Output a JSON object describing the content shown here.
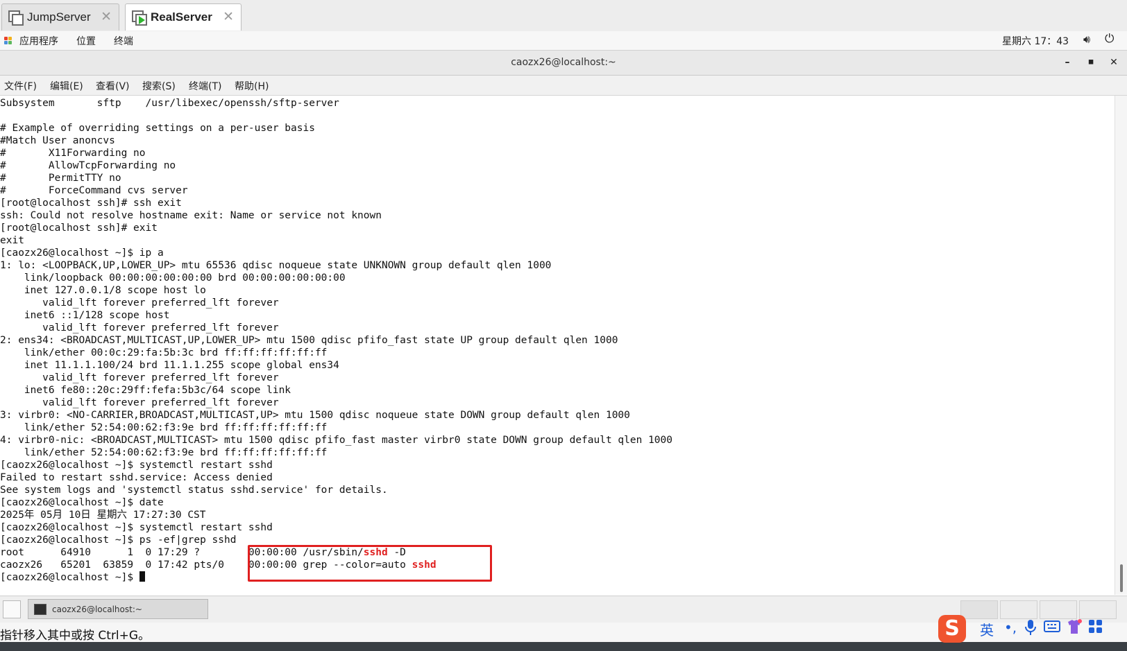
{
  "vm_tabs": [
    {
      "label": "JumpServer",
      "active": false
    },
    {
      "label": "RealServer",
      "active": true
    }
  ],
  "panel": {
    "applications": "应用程序",
    "places": "位置",
    "terminal": "终端",
    "datetime": "星期六 17：43",
    "icons": [
      "volume-icon",
      "power-icon"
    ]
  },
  "window": {
    "title": "caozx26@localhost:~",
    "controls": [
      "minimize",
      "maximize",
      "close"
    ]
  },
  "menu": [
    "文件(F)",
    "编辑(E)",
    "查看(V)",
    "搜索(S)",
    "终端(T)",
    "帮助(H)"
  ],
  "terminal": {
    "lines": [
      "Subsystem       sftp    /usr/libexec/openssh/sftp-server",
      "",
      "# Example of overriding settings on a per-user basis",
      "#Match User anoncvs",
      "#       X11Forwarding no",
      "#       AllowTcpForwarding no",
      "#       PermitTTY no",
      "#       ForceCommand cvs server",
      "[root@localhost ssh]# ssh exit",
      "ssh: Could not resolve hostname exit: Name or service not known",
      "[root@localhost ssh]# exit",
      "exit",
      "[caozx26@localhost ~]$ ip a",
      "1: lo: <LOOPBACK,UP,LOWER_UP> mtu 65536 qdisc noqueue state UNKNOWN group default qlen 1000",
      "    link/loopback 00:00:00:00:00:00 brd 00:00:00:00:00:00",
      "    inet 127.0.0.1/8 scope host lo",
      "       valid_lft forever preferred_lft forever",
      "    inet6 ::1/128 scope host",
      "       valid_lft forever preferred_lft forever",
      "2: ens34: <BROADCAST,MULTICAST,UP,LOWER_UP> mtu 1500 qdisc pfifo_fast state UP group default qlen 1000",
      "    link/ether 00:0c:29:fa:5b:3c brd ff:ff:ff:ff:ff:ff",
      "    inet 11.1.1.100/24 brd 11.1.1.255 scope global ens34",
      "       valid_lft forever preferred_lft forever",
      "    inet6 fe80::20c:29ff:fefa:5b3c/64 scope link",
      "       valid_lft forever preferred_lft forever",
      "3: virbr0: <NO-CARRIER,BROADCAST,MULTICAST,UP> mtu 1500 qdisc noqueue state DOWN group default qlen 1000",
      "    link/ether 52:54:00:62:f3:9e brd ff:ff:ff:ff:ff:ff",
      "4: virbr0-nic: <BROADCAST,MULTICAST> mtu 1500 qdisc pfifo_fast master virbr0 state DOWN group default qlen 1000",
      "    link/ether 52:54:00:62:f3:9e brd ff:ff:ff:ff:ff:ff",
      "[caozx26@localhost ~]$ systemctl restart sshd",
      "Failed to restart sshd.service: Access denied",
      "See system logs and 'systemctl status sshd.service' for details.",
      "[caozx26@localhost ~]$ date",
      "2025年 05月 10日 星期六 17:27:30 CST",
      "[caozx26@localhost ~]$ systemctl restart sshd",
      "[caozx26@localhost ~]$ ps -ef|grep sshd"
    ],
    "ps_rows": [
      {
        "prefix": "root      64910      1  0 17:29 ?        00:00:00 /usr/sbin/",
        "match": "sshd",
        "suffix": " -D"
      },
      {
        "prefix": "caozx26   65201  63859  0 17:42 pts/0    00:00:00 grep --color=auto ",
        "match": "sshd",
        "suffix": ""
      }
    ],
    "final_prompt": "[caozx26@localhost ~]$ ",
    "match_color": "#e02020"
  },
  "taskbar": {
    "window_label": "caozx26@localhost:~"
  },
  "hint": {
    "text": "指针移入其中或按 Ctrl+G。"
  },
  "ime": {
    "logo": "S",
    "lang": "英",
    "punct": "•,",
    "icons": [
      "microphone-icon",
      "keyboard-icon",
      "skin-icon",
      "grid-icon"
    ]
  }
}
